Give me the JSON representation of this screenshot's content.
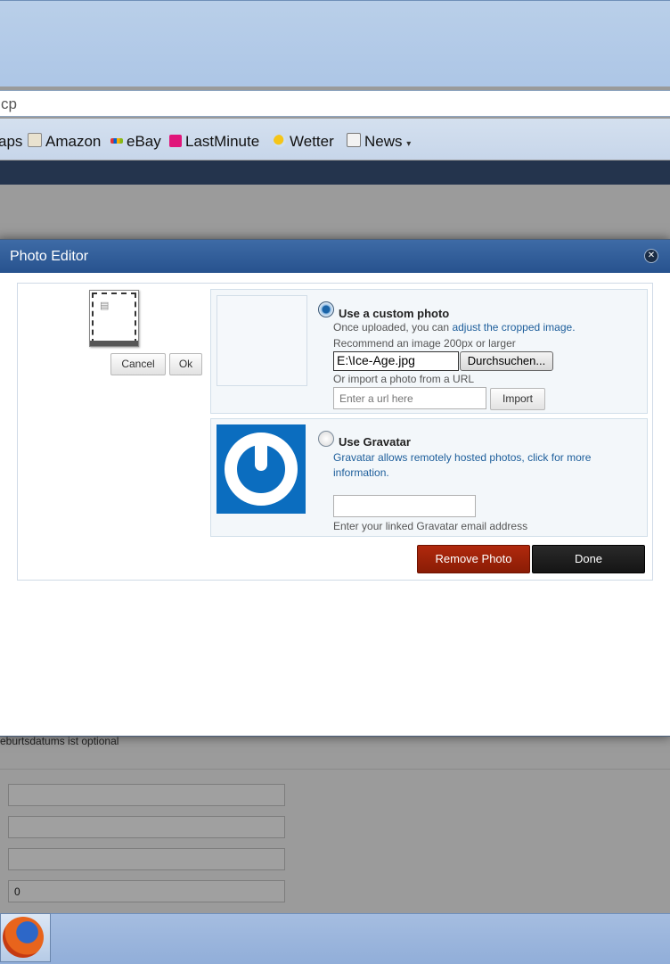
{
  "browser": {
    "url_fragment": "cp",
    "bookmarks": [
      {
        "label": "aps",
        "icon": "none"
      },
      {
        "label": "Amazon",
        "icon": "amazon-icon"
      },
      {
        "label": "eBay",
        "icon": "ebay-icon"
      },
      {
        "label": "LastMinute",
        "icon": "lastminute-icon"
      },
      {
        "label": "Wetter",
        "icon": "weather-icon"
      },
      {
        "label": "News",
        "icon": "news-icon"
      }
    ],
    "news_dropdown": "▾"
  },
  "background": {
    "note": "eburtsdatums ist optional",
    "field_values": [
      "",
      "",
      "",
      "0"
    ]
  },
  "dialog": {
    "title": "Photo Editor",
    "close_glyph": "✕",
    "crop": {
      "cancel": "Cancel",
      "ok": "Ok"
    },
    "custom": {
      "title": "Use a custom photo",
      "line1_prefix": "Once uploaded, you can ",
      "line1_link": "adjust the cropped image.",
      "recommend": "Recommend an image 200px or larger",
      "file_value": "E:\\Ice-Age.jpg",
      "browse": "Durchsuchen...",
      "import_label": "Or import a photo from a URL",
      "url_placeholder": "Enter a url here",
      "import_button": "Import"
    },
    "gravatar": {
      "title": "Use Gravatar",
      "desc": "Gravatar allows remotely hosted photos, click for more information.",
      "email_value": "",
      "hint": "Enter your linked Gravatar email address"
    },
    "remove_photo": "Remove Photo",
    "done": "Done"
  },
  "colors": {
    "header": "#2f5d99",
    "remove": "#9e1c06",
    "done": "#1c1c1c",
    "gravatar": "#0b6dbf"
  }
}
